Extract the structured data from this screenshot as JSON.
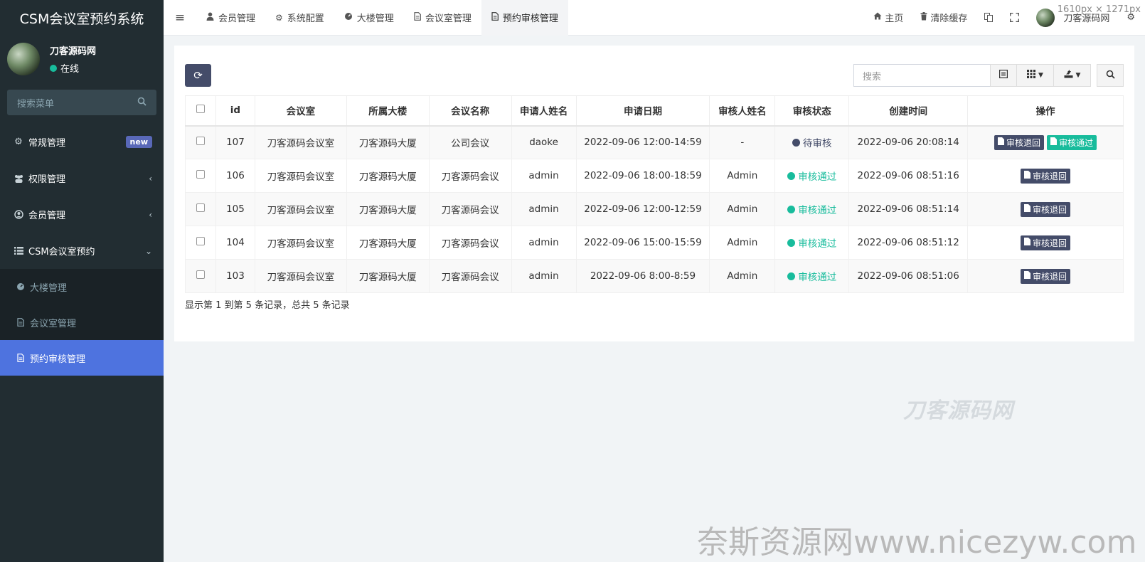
{
  "sidebar": {
    "brand": "CSM会议室预约系统",
    "user_name": "刀客源码网",
    "user_status": "在线",
    "search_placeholder": "搜索菜单",
    "menu": [
      {
        "label": "常规管理",
        "badge": "new"
      },
      {
        "label": "权限管理"
      },
      {
        "label": "会员管理"
      },
      {
        "label": "CSM会议室预约"
      }
    ],
    "submenu": [
      {
        "label": "大楼管理"
      },
      {
        "label": "会议室管理"
      },
      {
        "label": "预约审核管理"
      }
    ]
  },
  "header": {
    "tabs": [
      {
        "label": "会员管理"
      },
      {
        "label": "系统配置"
      },
      {
        "label": "大楼管理"
      },
      {
        "label": "会议室管理"
      },
      {
        "label": "预约审核管理"
      }
    ],
    "home": "主页",
    "clear_cache": "清除缓存",
    "user_name": "刀客源码网",
    "dims": "1610px × 1271px"
  },
  "toolbar": {
    "search_placeholder": "搜索"
  },
  "table": {
    "columns": [
      "id",
      "会议室",
      "所属大楼",
      "会议名称",
      "申请人姓名",
      "申请日期",
      "审核人姓名",
      "审核状态",
      "创建时间",
      "操作"
    ],
    "rows": [
      {
        "id": "107",
        "room": "刀客源码会议室",
        "building": "刀客源码大厦",
        "meeting": "公司会议",
        "applicant": "daoke",
        "date": "2022-09-06 12:00-14:59",
        "reviewer": "-",
        "status": "待审核",
        "created": "2022-09-06 20:08:14"
      },
      {
        "id": "106",
        "room": "刀客源码会议室",
        "building": "刀客源码大厦",
        "meeting": "刀客源码会议",
        "applicant": "admin",
        "date": "2022-09-06 18:00-18:59",
        "reviewer": "Admin",
        "status": "审核通过",
        "created": "2022-09-06 08:51:16"
      },
      {
        "id": "105",
        "room": "刀客源码会议室",
        "building": "刀客源码大厦",
        "meeting": "刀客源码会议",
        "applicant": "admin",
        "date": "2022-09-06 12:00-12:59",
        "reviewer": "Admin",
        "status": "审核通过",
        "created": "2022-09-06 08:51:14"
      },
      {
        "id": "104",
        "room": "刀客源码会议室",
        "building": "刀客源码大厦",
        "meeting": "刀客源码会议",
        "applicant": "admin",
        "date": "2022-09-06 15:00-15:59",
        "reviewer": "Admin",
        "status": "审核通过",
        "created": "2022-09-06 08:51:12"
      },
      {
        "id": "103",
        "room": "刀客源码会议室",
        "building": "刀客源码大厦",
        "meeting": "刀客源码会议",
        "applicant": "admin",
        "date": "2022-09-06 8:00-8:59",
        "reviewer": "Admin",
        "status": "审核通过",
        "created": "2022-09-06 08:51:06"
      }
    ],
    "op_reject": "审核退回",
    "op_pass": "审核通过"
  },
  "pager": {
    "summary": "显示第 1 到第 5 条记录，总共 5 条记录"
  },
  "watermarks": {
    "logo": "刀客源码网",
    "footer": "奈斯资源网www.nicezyw.com"
  },
  "colors": {
    "sidebar_bg": "#222d32",
    "active_blue": "#4e73df",
    "primary_dark": "#444c69",
    "success": "#18bc9c"
  }
}
